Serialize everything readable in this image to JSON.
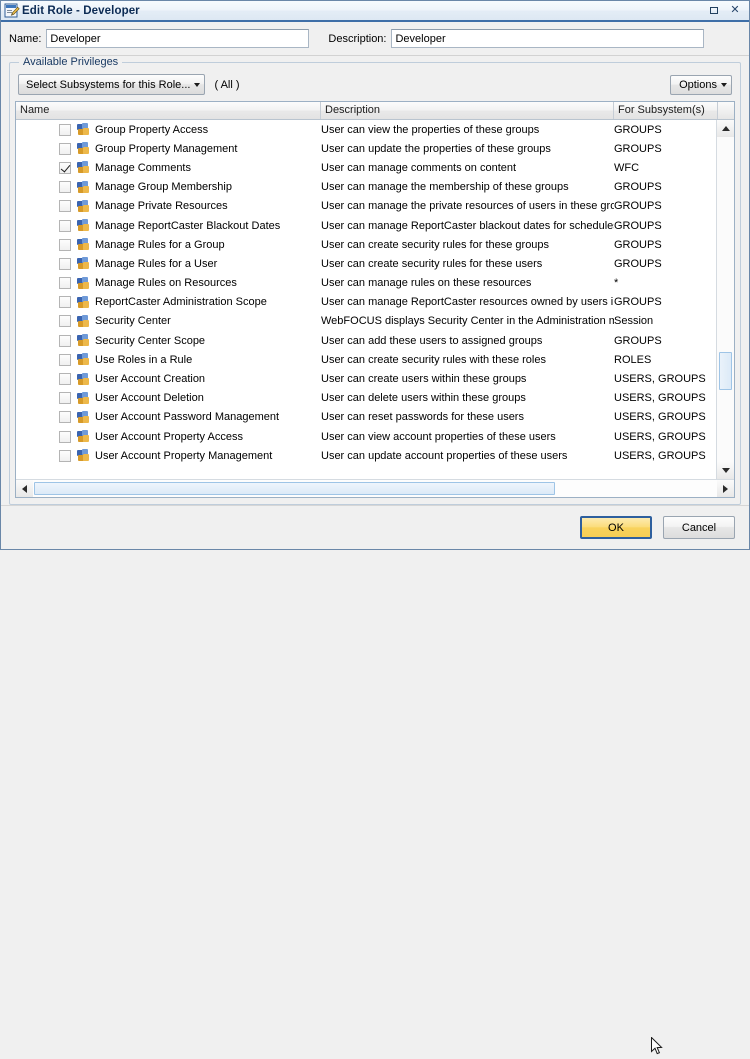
{
  "window": {
    "title": "Edit Role - Developer",
    "icon": "edit-role-icon",
    "maximize_label": "",
    "close_label": "✕"
  },
  "fields": {
    "name_label": "Name:",
    "name_value": "Developer",
    "name_placeholder": "",
    "description_label": "Description:",
    "description_value": "Developer",
    "description_placeholder": ""
  },
  "group": {
    "legend": "Available Privileges",
    "subsystem_button": "Select Subsystems for this Role...",
    "subsystem_scope": "( All )",
    "options_button": "Options"
  },
  "grid": {
    "columns": [
      "Name",
      "Description",
      "For Subsystem(s)"
    ],
    "rows": [
      {
        "checked": false,
        "name": "Group Property Access",
        "description": "User can view the properties of these groups",
        "subsystems": "GROUPS"
      },
      {
        "checked": false,
        "name": "Group Property Management",
        "description": "User can update the properties of these groups",
        "subsystems": "GROUPS"
      },
      {
        "checked": true,
        "name": "Manage Comments",
        "description": "User can manage comments on content",
        "subsystems": "WFC"
      },
      {
        "checked": false,
        "name": "Manage Group Membership",
        "description": "User can manage the membership of these groups",
        "subsystems": "GROUPS"
      },
      {
        "checked": false,
        "name": "Manage Private Resources",
        "description": "User can manage the private resources of users in these grou",
        "subsystems": "GROUPS"
      },
      {
        "checked": false,
        "name": "Manage ReportCaster Blackout Dates",
        "description": "User can manage ReportCaster blackout dates for schedules i",
        "subsystems": "GROUPS"
      },
      {
        "checked": false,
        "name": "Manage Rules for a Group",
        "description": "User can create security rules for these groups",
        "subsystems": "GROUPS"
      },
      {
        "checked": false,
        "name": "Manage Rules for a User",
        "description": "User can create security rules for these users",
        "subsystems": "GROUPS"
      },
      {
        "checked": false,
        "name": "Manage Rules on Resources",
        "description": "User can manage rules on these resources",
        "subsystems": "*"
      },
      {
        "checked": false,
        "name": "ReportCaster Administration Scope",
        "description": "User can manage ReportCaster resources owned by users in t",
        "subsystems": "GROUPS"
      },
      {
        "checked": false,
        "name": "Security Center",
        "description": "WebFOCUS displays Security Center in the Administration mer",
        "subsystems": "Session"
      },
      {
        "checked": false,
        "name": "Security Center Scope",
        "description": "User can add these users to assigned groups",
        "subsystems": "GROUPS"
      },
      {
        "checked": false,
        "name": "Use Roles in a Rule",
        "description": "User can create security rules with these roles",
        "subsystems": "ROLES"
      },
      {
        "checked": false,
        "name": "User Account Creation",
        "description": "User can create users within these groups",
        "subsystems": "USERS, GROUPS"
      },
      {
        "checked": false,
        "name": "User Account Deletion",
        "description": "User can delete users within these groups",
        "subsystems": "USERS, GROUPS"
      },
      {
        "checked": false,
        "name": "User Account Password Management",
        "description": "User can reset passwords for these users",
        "subsystems": "USERS, GROUPS"
      },
      {
        "checked": false,
        "name": "User Account Property Access",
        "description": "User can view account properties of these users",
        "subsystems": "USERS, GROUPS"
      },
      {
        "checked": false,
        "name": "User Account Property Management",
        "description": "User can update account properties of these users",
        "subsystems": "USERS, GROUPS"
      }
    ]
  },
  "footer": {
    "ok_label": "OK",
    "cancel_label": "Cancel"
  },
  "colors": {
    "title_accent": "#3f6fa8",
    "primary_button": "#f8d25c",
    "primary_button_border": "#2e5f9e",
    "group_border": "#bfcddb"
  }
}
